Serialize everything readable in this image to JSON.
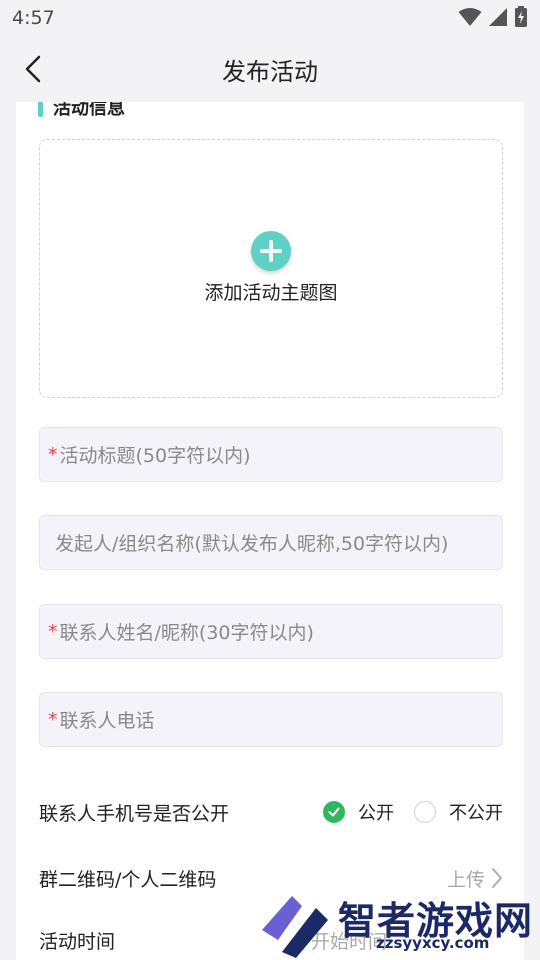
{
  "status_bar": {
    "time": "4:57"
  },
  "nav": {
    "title": "发布活动"
  },
  "section": {
    "title": "活动信息"
  },
  "upload": {
    "label": "添加活动主题图"
  },
  "fields": {
    "activity_title": {
      "required_mark": "*",
      "placeholder": "活动标题(50字符以内)"
    },
    "organizer": {
      "placeholder": "发起人/组织名称(默认发布人昵称,50字符以内)"
    },
    "contact_name": {
      "required_mark": "*",
      "placeholder": "联系人姓名/昵称(30字符以内)"
    },
    "contact_phone": {
      "required_mark": "*",
      "placeholder": "联系人电话"
    }
  },
  "phone_public": {
    "label": "联系人手机号是否公开",
    "options": [
      {
        "label": "公开",
        "selected": true
      },
      {
        "label": "不公开",
        "selected": false
      }
    ]
  },
  "qr_code": {
    "label": "群二维码/个人二维码",
    "action": "上传"
  },
  "activity_time": {
    "label": "活动时间",
    "value": "开始时间"
  },
  "watermark": {
    "text": "智者游戏网",
    "sub": "zzsyyxcy.com"
  },
  "colors": {
    "accent": "#5fd0c4",
    "selected_radio": "#2fb860",
    "required": "#e64545",
    "field_bg": "#f4f3f9"
  }
}
